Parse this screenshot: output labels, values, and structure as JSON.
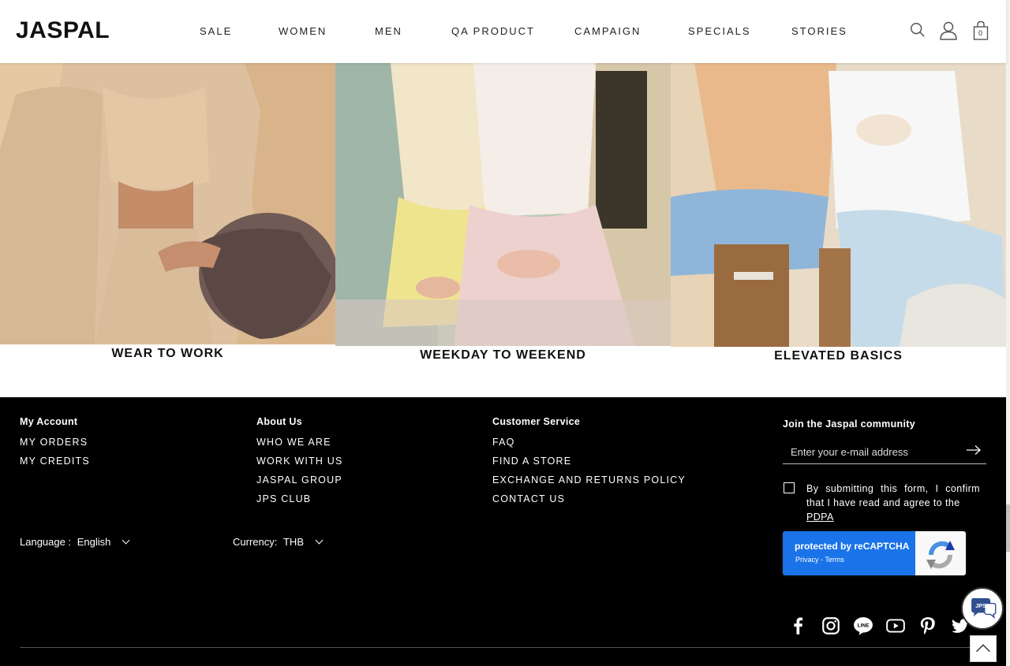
{
  "header": {
    "logo": "JASPAL",
    "nav": [
      "SALE",
      "WOMEN",
      "MEN",
      "QA PRODUCT",
      "CAMPAIGN",
      "SPECIALS",
      "STORIES"
    ],
    "cart_count": "0"
  },
  "tiles": [
    {
      "caption": "WEAR TO WORK"
    },
    {
      "caption": "WEEKDAY TO WEEKEND"
    },
    {
      "caption": "ELEVATED BASICS"
    }
  ],
  "footer": {
    "account": {
      "title": "My Account",
      "links": [
        "MY ORDERS",
        "MY CREDITS"
      ]
    },
    "about": {
      "title": "About Us",
      "links": [
        "WHO WE ARE",
        "WORK WITH US",
        "JASPAL GROUP",
        "JPS CLUB"
      ]
    },
    "service": {
      "title": "Customer Service",
      "links": [
        "FAQ",
        "FIND A STORE",
        "EXCHANGE AND RETURNS POLICY",
        "CONTACT US"
      ]
    },
    "language": {
      "label": "Language :",
      "value": "English"
    },
    "currency": {
      "label": "Currency:",
      "value": "THB"
    },
    "newsletter": {
      "title": "Join the Jaspal community",
      "placeholder": "Enter your e-mail address",
      "consent": "By submitting this form, I confirm that I have read and agree to the",
      "consent_link": "PDPA"
    },
    "recaptcha": {
      "title": "protected by reCAPTCHA",
      "links": "Privacy - Terms"
    },
    "social_icons": [
      "facebook-icon",
      "instagram-icon",
      "line-icon",
      "youtube-icon",
      "pinterest-icon",
      "twitter-icon"
    ],
    "chat_badge": "JPS"
  }
}
